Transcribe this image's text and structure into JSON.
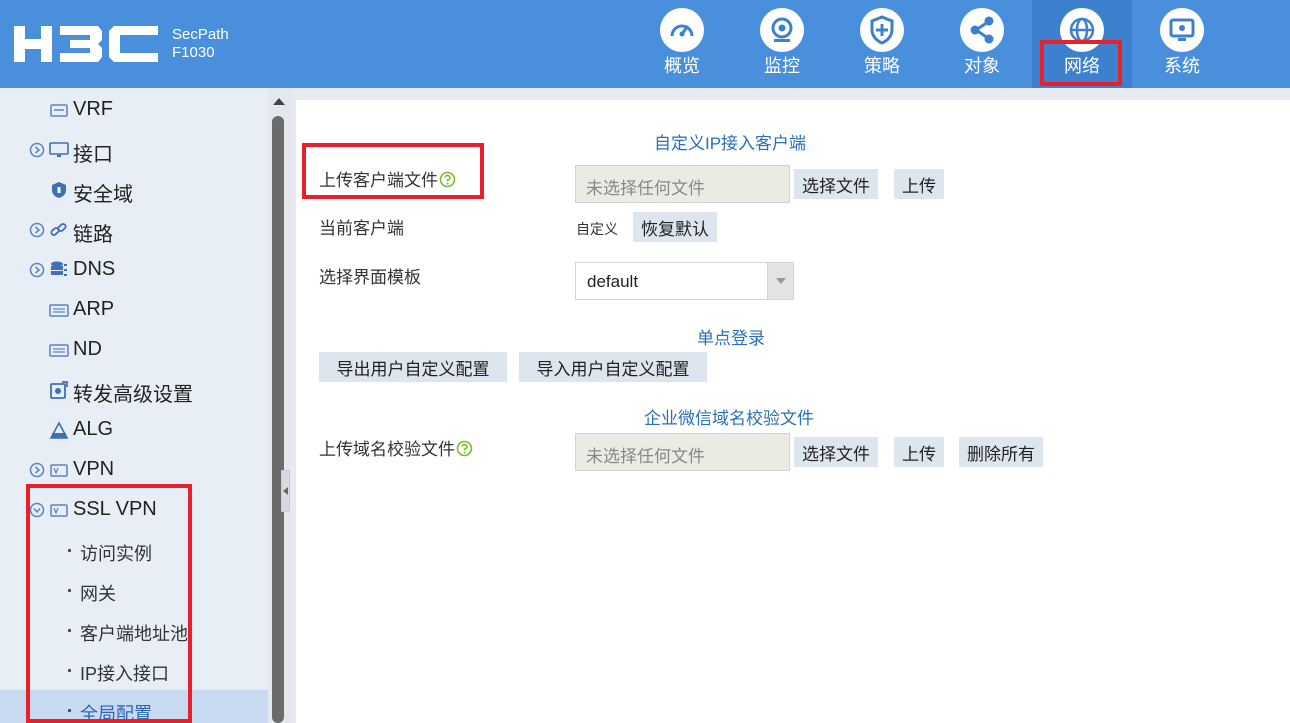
{
  "header": {
    "logo_text": "H3C",
    "product_line1": "SecPath",
    "product_line2": "F1030",
    "nav": [
      {
        "label": "概览",
        "icon": "dashboard-icon",
        "active": false
      },
      {
        "label": "监控",
        "icon": "monitor-eye-icon",
        "active": false
      },
      {
        "label": "策略",
        "icon": "shield-plus-icon",
        "active": false
      },
      {
        "label": "对象",
        "icon": "share-nodes-icon",
        "active": false
      },
      {
        "label": "网络",
        "icon": "globe-icon",
        "active": true
      },
      {
        "label": "系统",
        "icon": "display-gear-icon",
        "active": false
      }
    ]
  },
  "sidebar": {
    "items": [
      {
        "label": "VRF",
        "icon": "vrf-icon"
      },
      {
        "label": "接口",
        "icon": "interface-monitor-icon",
        "expandable": true
      },
      {
        "label": "安全域",
        "icon": "security-zone-shield-icon"
      },
      {
        "label": "链路",
        "icon": "link-chain-icon",
        "expandable": true
      },
      {
        "label": "DNS",
        "icon": "dns-database-icon",
        "expandable": true
      },
      {
        "label": "ARP",
        "icon": "arp-keyboard-icon"
      },
      {
        "label": "ND",
        "icon": "nd-keyboard-icon"
      },
      {
        "label": "转发高级设置",
        "icon": "forwarding-settings-icon"
      },
      {
        "label": "ALG",
        "icon": "alg-icon"
      },
      {
        "label": "VPN",
        "icon": "vpn-icon",
        "expandable": true
      },
      {
        "label": "SSL VPN",
        "icon": "ssl-vpn-icon",
        "expandable": true,
        "expanded": true
      }
    ],
    "sub_items": [
      {
        "label": "访问实例"
      },
      {
        "label": "网关"
      },
      {
        "label": "客户端地址池"
      },
      {
        "label": "IP接入接口"
      },
      {
        "label": "全局配置",
        "selected": true
      }
    ]
  },
  "main": {
    "section1_title": "自定义IP接入客户端",
    "upload_client_label": "上传客户端文件",
    "file_placeholder": "未选择任何文件",
    "choose_file": "选择文件",
    "upload": "上传",
    "current_client_label": "当前客户端",
    "current_client_value": "自定义",
    "restore_default": "恢复默认",
    "template_label": "选择界面模板",
    "template_value": "default",
    "section2_title": "单点登录",
    "export_config": "导出用户自定义配置",
    "import_config": "导入用户自定义配置",
    "section3_title": "企业微信域名校验文件",
    "upload_domain_label": "上传域名校验文件",
    "domain_file_placeholder": "未选择任何文件",
    "choose_file2": "选择文件",
    "upload2": "上传",
    "delete_all": "删除所有"
  },
  "colors": {
    "header_bg": "#4a8fdc",
    "header_active": "#3c80ce",
    "sidebar_bg": "#e8eef6",
    "sidebar_selected": "#c8daf0",
    "section_title": "#2a6fb8",
    "annotation": "#e8202a"
  }
}
